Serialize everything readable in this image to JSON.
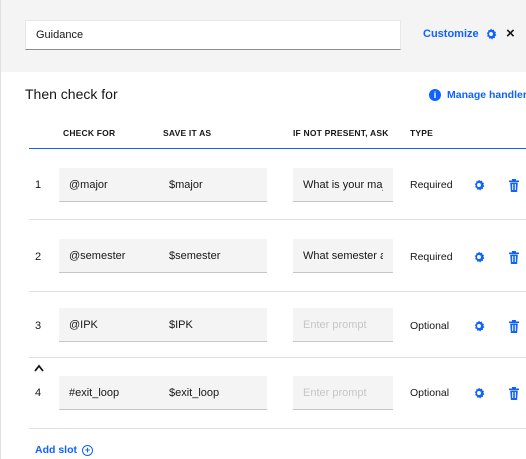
{
  "header": {
    "name_value": "Guidance",
    "customize_label": "Customize",
    "close_label": "×"
  },
  "section": {
    "title": "Then check for",
    "manage_label": "Manage handlers"
  },
  "table": {
    "columns": [
      "CHECK FOR",
      "SAVE IT AS",
      "IF NOT PRESENT, ASK",
      "TYPE"
    ],
    "prompt_placeholder": "Enter prompt",
    "rows": [
      {
        "num": "1",
        "check_for": "@major",
        "save_as": "$major",
        "ask": "What is your major?",
        "type": "Required"
      },
      {
        "num": "2",
        "check_for": "@semester",
        "save_as": "$semester",
        "ask": "What semester are",
        "type": "Required"
      },
      {
        "num": "3",
        "check_for": "@IPK",
        "save_as": "$IPK",
        "ask": "",
        "type": "Optional"
      },
      {
        "num": "4",
        "check_for": "#exit_loop",
        "save_as": "$exit_loop",
        "ask": "",
        "type": "Optional"
      }
    ]
  },
  "footer": {
    "add_slot_label": "Add slot"
  },
  "colors": {
    "accent": "#0f62fe",
    "field_bg": "#f4f4f4",
    "top_bar_bg": "#f4f4f4"
  },
  "icons": [
    "gear-icon",
    "close-icon",
    "info-icon",
    "trash-icon",
    "chevron-up-icon",
    "plus-circle-icon"
  ]
}
